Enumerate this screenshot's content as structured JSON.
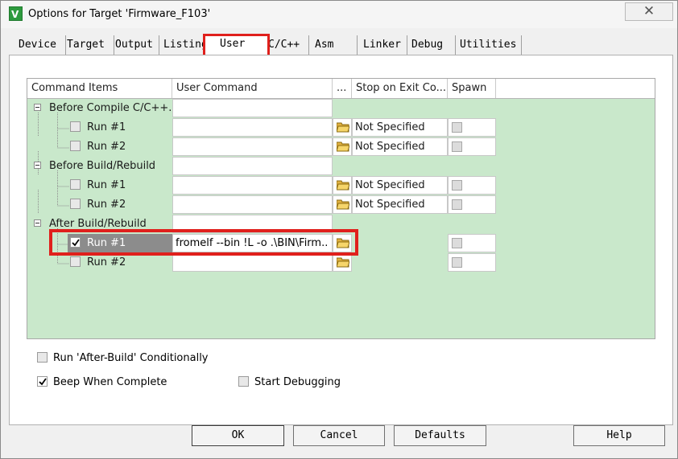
{
  "window": {
    "title": "Options for Target 'Firmware_F103'",
    "close_symbol": "✕"
  },
  "tabs": [
    {
      "label": "Device"
    },
    {
      "label": "Target"
    },
    {
      "label": "Output"
    },
    {
      "label": "Listing"
    },
    {
      "label": "User",
      "active": true
    },
    {
      "label": "C/C++"
    },
    {
      "label": "Asm"
    },
    {
      "label": "Linker"
    },
    {
      "label": "Debug"
    },
    {
      "label": "Utilities"
    }
  ],
  "grid": {
    "columns": [
      "Command Items",
      "User Command",
      "...",
      "Stop on Exit Co...",
      "Spawn"
    ],
    "groups": [
      {
        "label": "Before Compile C/C++...",
        "items": [
          {
            "label": "Run #1",
            "checked": false,
            "command": "",
            "stop_on_exit": "Not Specified",
            "spawn": false
          },
          {
            "label": "Run #2",
            "checked": false,
            "command": "",
            "stop_on_exit": "Not Specified",
            "spawn": false
          }
        ]
      },
      {
        "label": "Before Build/Rebuild",
        "items": [
          {
            "label": "Run #1",
            "checked": false,
            "command": "",
            "stop_on_exit": "Not Specified",
            "spawn": false
          },
          {
            "label": "Run #2",
            "checked": false,
            "command": "",
            "stop_on_exit": "Not Specified",
            "spawn": false
          }
        ]
      },
      {
        "label": "After Build/Rebuild",
        "items": [
          {
            "label": "Run #1",
            "checked": true,
            "command": "fromelf --bin !L -o .\\BIN\\Firm...",
            "stop_on_exit": "",
            "spawn": false,
            "selected": true
          },
          {
            "label": "Run #2",
            "checked": false,
            "command": "",
            "stop_on_exit": "",
            "spawn": false
          }
        ]
      }
    ]
  },
  "options": {
    "run_after_build_conditionally": {
      "label": "Run 'After-Build' Conditionally",
      "checked": false
    },
    "beep_when_complete": {
      "label": "Beep When Complete",
      "checked": true
    },
    "start_debugging": {
      "label": "Start Debugging",
      "checked": false
    }
  },
  "buttons": {
    "ok": "OK",
    "cancel": "Cancel",
    "defaults": "Defaults",
    "help": "Help"
  },
  "colors": {
    "grid_bg": "#c9e8cb",
    "highlight": "#e0201c",
    "selected_row": "#8c8c8c"
  },
  "icons": {
    "app": "keil-uvision-icon",
    "folder": "folder-open-icon",
    "close": "close-icon"
  }
}
